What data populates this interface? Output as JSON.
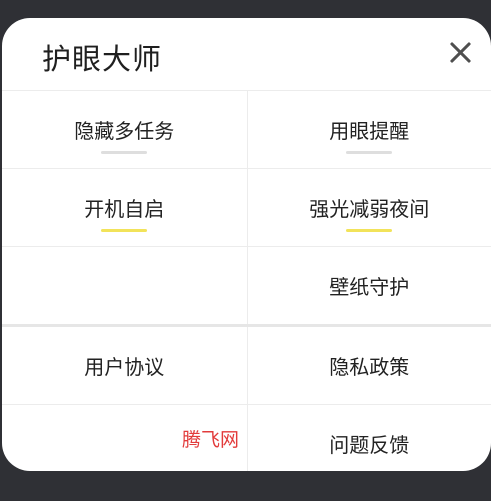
{
  "dialog": {
    "title": "护眼大师",
    "close_icon": "close-icon"
  },
  "colors": {
    "toggle_on": "#f2e35a",
    "toggle_off": "#dedede"
  },
  "toggles": [
    {
      "label": "隐藏多任务",
      "state": "off"
    },
    {
      "label": "用眼提醒",
      "state": "off"
    },
    {
      "label": "开机自启",
      "state": "on"
    },
    {
      "label": "强光减弱夜间",
      "state": "on"
    }
  ],
  "menu": {
    "wallpaper": "壁纸守护",
    "user_agreement": "用户协议",
    "privacy_policy": "隐私政策",
    "feedback": "问题反馈"
  },
  "watermark": "腾飞网"
}
